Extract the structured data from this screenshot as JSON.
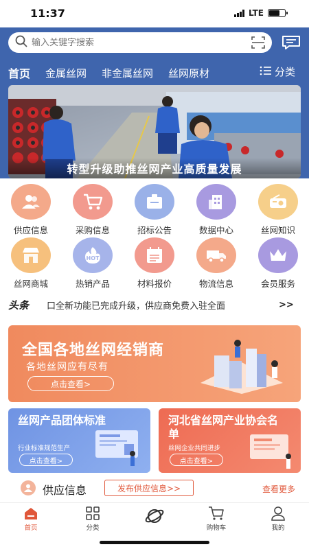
{
  "status": {
    "time": "11:37",
    "network": "LTE"
  },
  "search": {
    "placeholder": "输入关键字搜索"
  },
  "nav": {
    "tabs": [
      "首页",
      "金属丝网",
      "非金属丝网",
      "丝网原材"
    ],
    "more_label": "分类"
  },
  "banner": {
    "caption": "转型升级助推丝网产业高质量发展"
  },
  "grid": {
    "row1": [
      {
        "label": "供应信息",
        "icon": "people-icon",
        "color": "#f4a98a"
      },
      {
        "label": "采购信息",
        "icon": "cart-icon",
        "color": "#f29a8e"
      },
      {
        "label": "招标公告",
        "icon": "notice-icon",
        "color": "#9ab1e8"
      },
      {
        "label": "数据中心",
        "icon": "building-icon",
        "color": "#a89ae0"
      },
      {
        "label": "丝网知识",
        "icon": "radio-icon",
        "color": "#f6cf8a"
      }
    ],
    "row2": [
      {
        "label": "丝网商城",
        "icon": "shop-icon",
        "color": "#f6c07d"
      },
      {
        "label": "热销产品",
        "icon": "hot-icon",
        "color": "#a6b4ea"
      },
      {
        "label": "材料报价",
        "icon": "calendar-icon",
        "color": "#f29a8e"
      },
      {
        "label": "物流信息",
        "icon": "truck-icon",
        "color": "#f4a98a"
      },
      {
        "label": "会员服务",
        "icon": "crown-icon",
        "color": "#a89ae0"
      }
    ]
  },
  "ticker": {
    "logo": "头条",
    "text": "口全新功能已完成升级，供应商免费入驻全面",
    "more": ">>"
  },
  "promo_main": {
    "title": "全国各地丝网经销商",
    "subtitle": "各地丝网应有尽有",
    "button": "点击查看>"
  },
  "promo_left": {
    "title": "丝网产品团体标准",
    "subtitle": "行业标准规范生产",
    "button": "点击查看>"
  },
  "promo_right": {
    "title": "河北省丝网产业协会名单",
    "subtitle": "丝网企业共同进步",
    "button": "点击查看>"
  },
  "section": {
    "title": "供应信息",
    "publish_button": "发布供应信息>>",
    "see_more": "查看更多"
  },
  "tabbar": {
    "items": [
      {
        "label": "首页",
        "icon": "home-icon"
      },
      {
        "label": "分类",
        "icon": "category-icon"
      },
      {
        "label": "",
        "icon": "planet-icon"
      },
      {
        "label": "购物车",
        "icon": "cart-icon"
      },
      {
        "label": "我的",
        "icon": "user-icon"
      }
    ]
  },
  "colors": {
    "header_blue": "#3f65ad",
    "accent": "#e0573a"
  }
}
